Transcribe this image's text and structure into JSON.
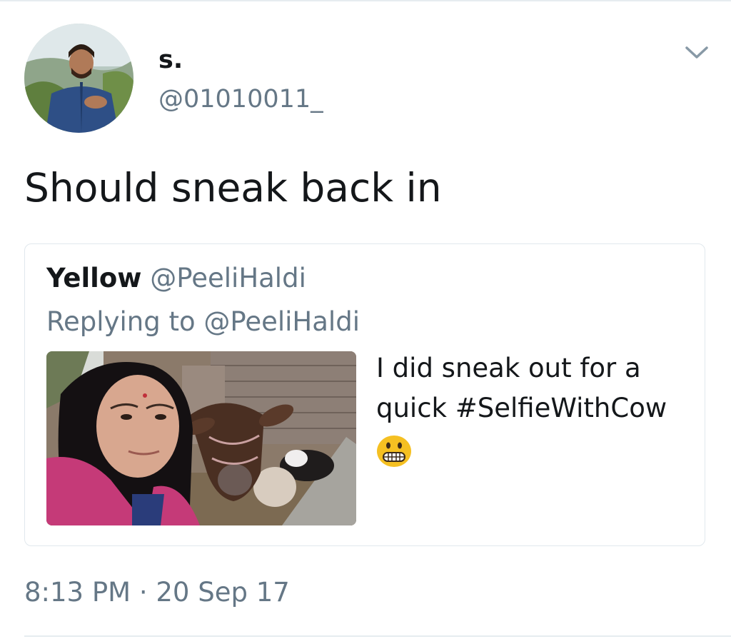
{
  "author": {
    "name": "s.",
    "handle": "@01010011_"
  },
  "tweet": {
    "text": "Should sneak back in",
    "timestamp": "8:13 PM · 20 Sep 17"
  },
  "quoted_tweet": {
    "name": "Yellow",
    "handle": "@PeeliHaldi",
    "replying_to": "Replying to @PeeliHaldi",
    "text": "I did sneak out for a quick #SelfieWithCow",
    "emoji": "grimacing-face"
  },
  "icons": {
    "menu": "chevron-down-icon"
  },
  "colors": {
    "text_primary": "#14171a",
    "text_secondary": "#657786",
    "border": "#e1e8ed"
  }
}
